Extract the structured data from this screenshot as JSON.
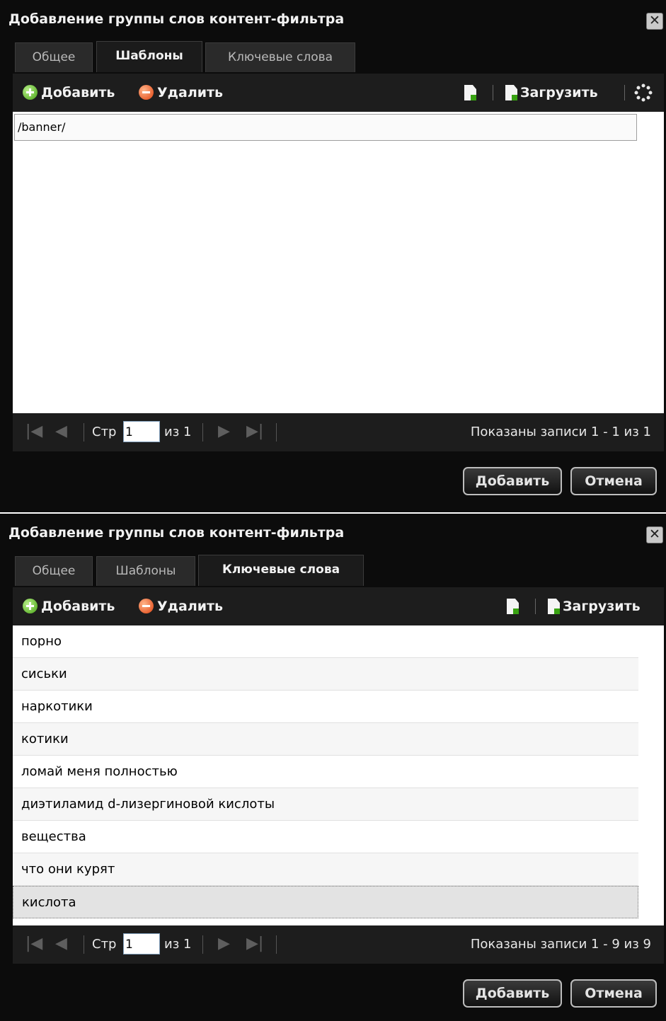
{
  "dialogs": [
    {
      "title": "Добавление группы слов контент-фильтра",
      "close_symbol": "✕",
      "tabs": [
        {
          "label": "Общее",
          "active": false
        },
        {
          "label": "Шаблоны",
          "active": true
        },
        {
          "label": "Ключевые слова",
          "active": false
        }
      ],
      "toolbar": {
        "add_label": "Добавить",
        "delete_label": "Удалить",
        "upload_label": "Загрузить",
        "icons": [
          "add-circle-icon",
          "delete-circle-icon",
          "export-document-icon",
          "upload-document-icon",
          "loading-spinner-icon"
        ]
      },
      "rows": [
        "/banner/"
      ],
      "pager": {
        "page_prefix": "Стр",
        "page_value": "1",
        "page_of": "из 1",
        "summary": "Показаны записи 1 - 1 из 1"
      },
      "buttons": {
        "submit_label": "Добавить",
        "cancel_label": "Отмена"
      }
    },
    {
      "title": "Добавление группы слов контент-фильтра",
      "close_symbol": "✕",
      "tabs": [
        {
          "label": "Общее",
          "active": false
        },
        {
          "label": "Шаблоны",
          "active": false
        },
        {
          "label": "Ключевые слова",
          "active": true
        }
      ],
      "toolbar": {
        "add_label": "Добавить",
        "delete_label": "Удалить",
        "upload_label": "Загрузить",
        "icons": [
          "add-circle-icon",
          "delete-circle-icon",
          "export-document-icon",
          "upload-document-icon"
        ]
      },
      "rows": [
        "порно",
        "сиськи",
        "наркотики",
        "котики",
        "ломай меня полностью",
        "диэтиламид d-лизергиновой кислоты",
        "вещества",
        "что они курят",
        "кислота"
      ],
      "selected_row": "кислота",
      "pager": {
        "page_prefix": "Стр",
        "page_value": "1",
        "page_of": "из 1",
        "summary": "Показаны записи 1 - 9 из 9"
      },
      "buttons": {
        "submit_label": "Добавить",
        "cancel_label": "Отмена"
      }
    }
  ],
  "colors": {
    "dialog_bg": "#0c0c0c",
    "toolbar_bg": "#1d1d1d",
    "add_icon_green": "#46a114",
    "delete_icon_red": "#e0420e",
    "grid_bg": "#ffffff"
  }
}
